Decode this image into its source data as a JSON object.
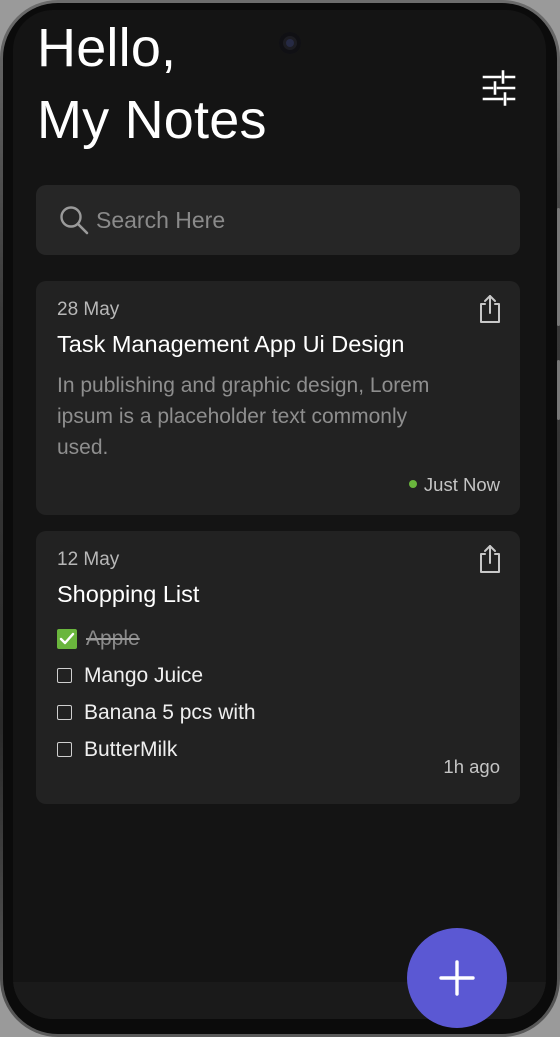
{
  "header": {
    "greeting_line1": "Hello,",
    "greeting_line2": "My Notes",
    "filter_icon": "sliders-icon"
  },
  "search": {
    "placeholder": "Search Here",
    "value": "",
    "icon": "search-icon"
  },
  "notes": [
    {
      "date": "28 May",
      "title": "Task Management App Ui Design",
      "body": "In publishing and graphic design, Lorem ipsum is a placeholder text commonly used.",
      "time": "Just Now",
      "status_color": "#6ab63d",
      "share_icon": "share-icon"
    },
    {
      "date": "12 May",
      "title": "Shopping List",
      "checklist": [
        {
          "label": "Apple",
          "checked": true
        },
        {
          "label": "Mango Juice",
          "checked": false
        },
        {
          "label": "Banana 5 pcs with",
          "checked": false
        },
        {
          "label": "ButterMilk",
          "checked": false
        }
      ],
      "time": "1h ago",
      "share_icon": "share-icon"
    }
  ],
  "fab": {
    "icon": "plus-icon",
    "color": "#5b58d3"
  },
  "theme": {
    "background": "#141414",
    "card": "#222222",
    "accent": "#6ab63d"
  }
}
